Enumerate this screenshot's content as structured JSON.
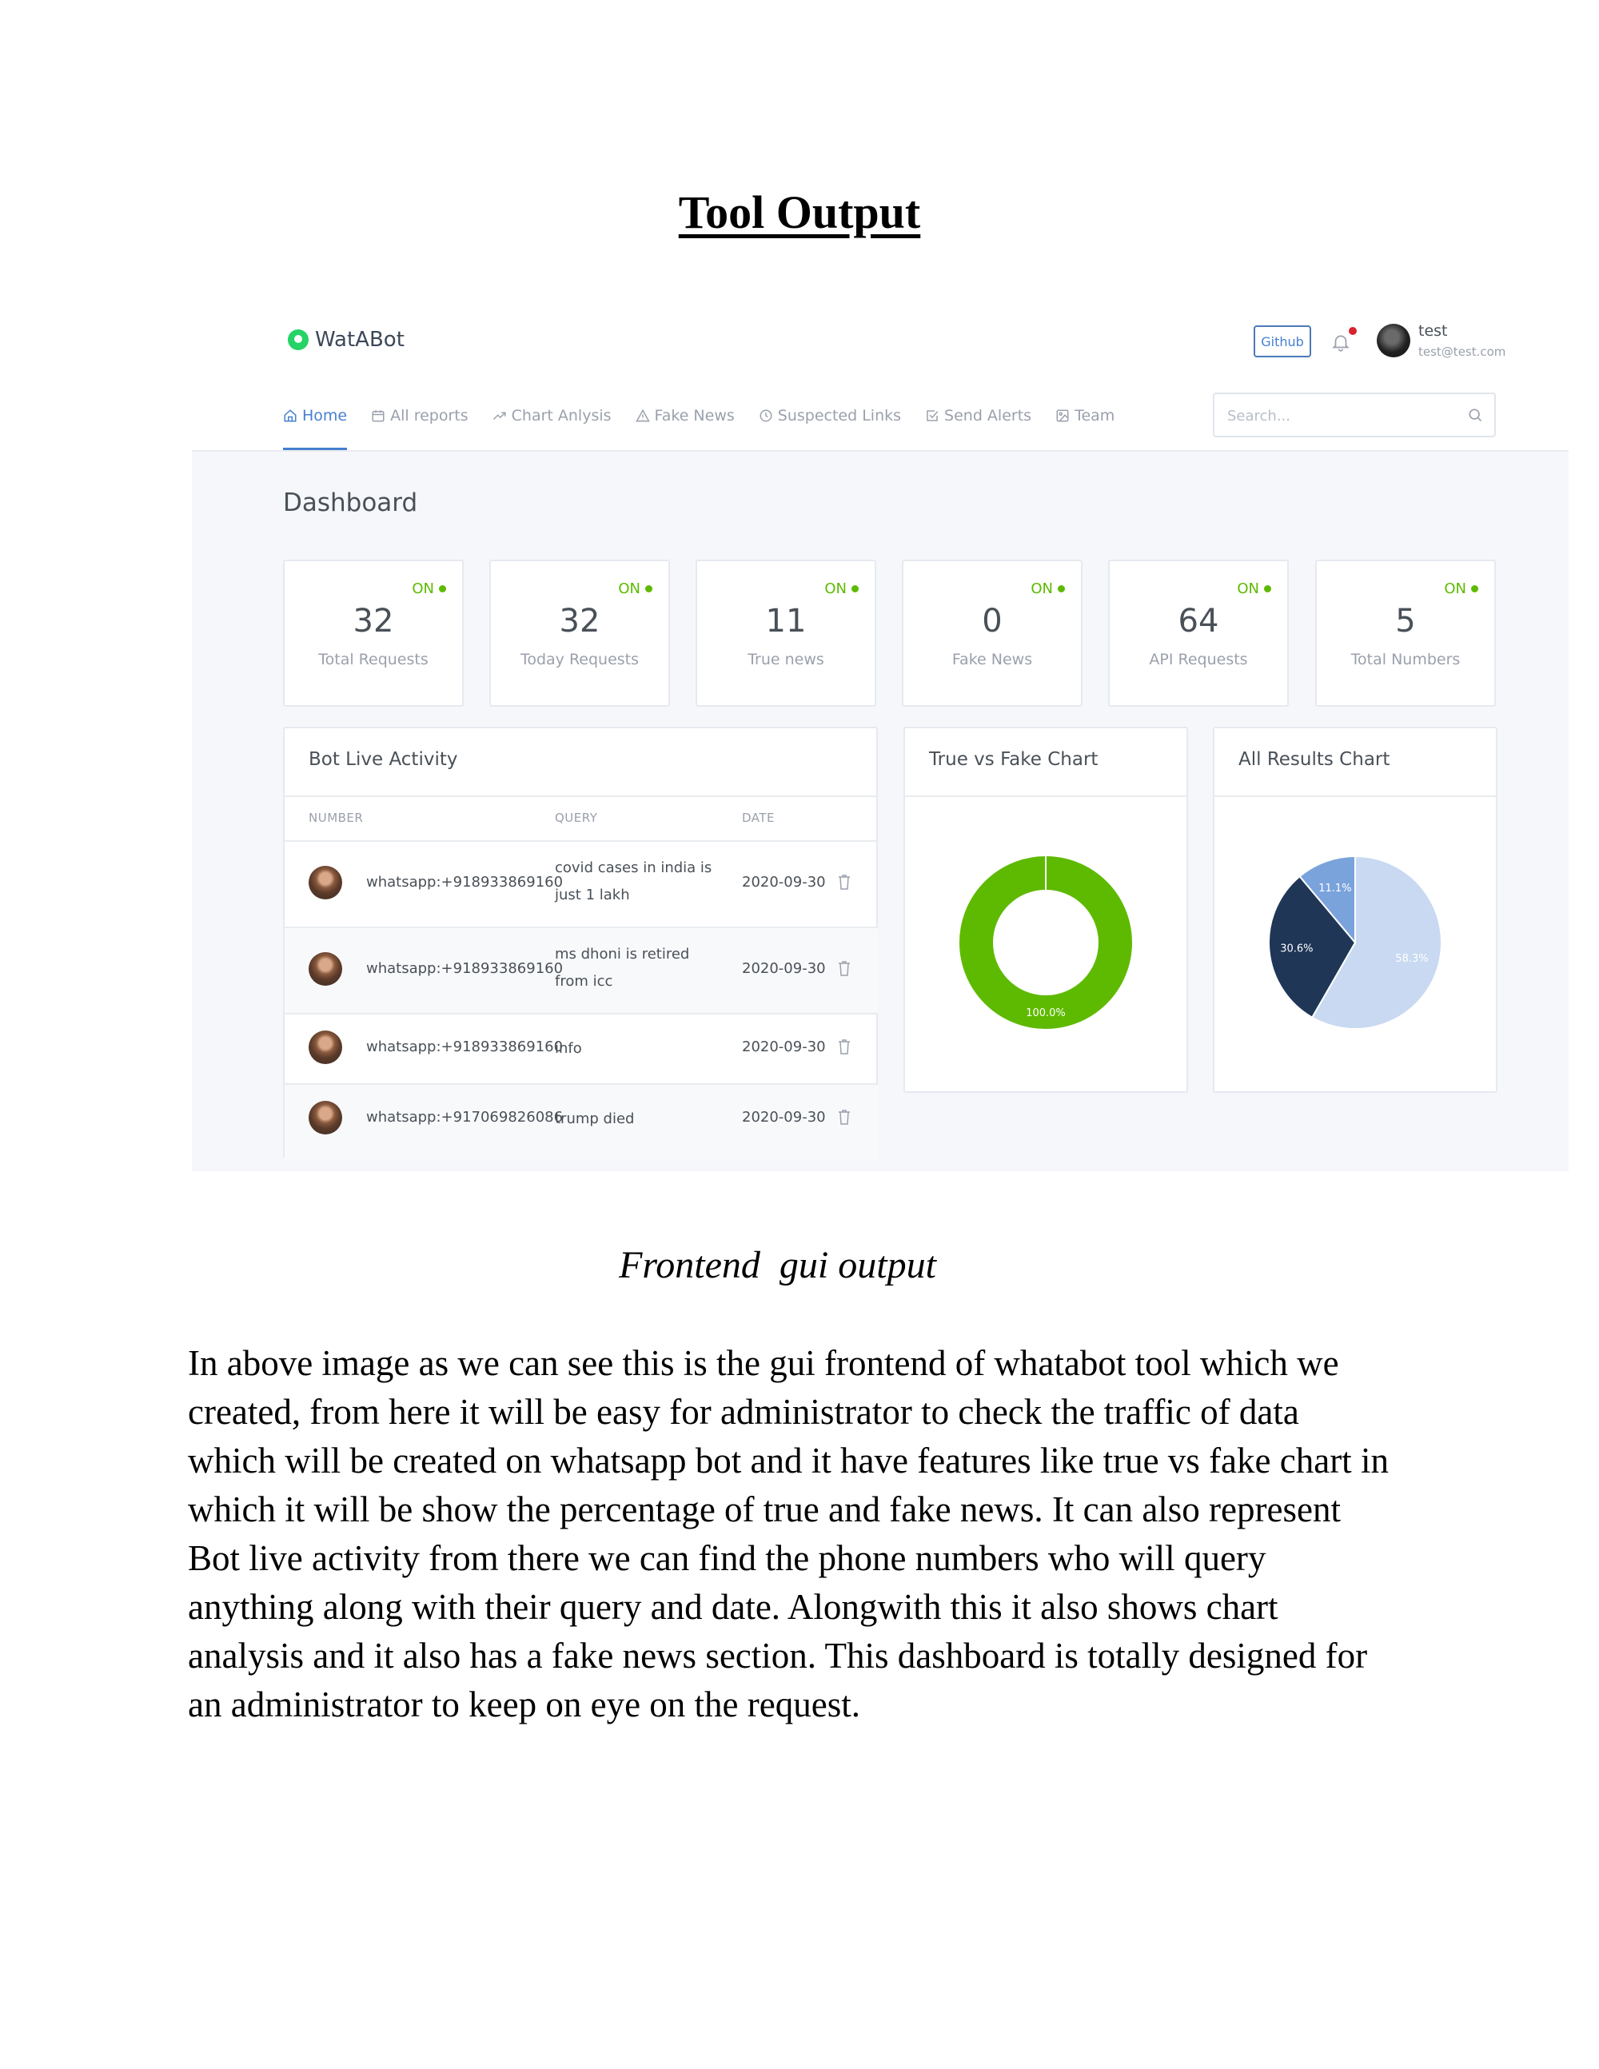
{
  "document": {
    "title": "Tool Output",
    "caption": "Frontend  gui output",
    "body_lines": [
      "In above image as we can see this is the gui frontend of whatabot tool which we",
      "created, from here it will be easy for administrator to check the traffic of data",
      "which will be created on whatsapp bot and it have features like true vs fake chart in",
      "which it will be show the percentage of true and fake news. It can also represent",
      "Bot live activity from there we can find the phone numbers who will query",
      "anything along with their query and date. Alongwith this it also shows chart",
      "analysis and it also has a fake news section. This dashboard is totally designed for",
      "an administrator to keep on eye on the request."
    ]
  },
  "app": {
    "brand": "WatABot",
    "github_label": "Github",
    "user": {
      "name": "test",
      "email": "test@test.com"
    },
    "nav": [
      {
        "label": "Home",
        "icon": "home-icon",
        "active": true
      },
      {
        "label": "All reports",
        "icon": "calendar-icon",
        "active": false
      },
      {
        "label": "Chart Anlysis",
        "icon": "trending-up-icon",
        "active": false
      },
      {
        "label": "Fake News",
        "icon": "alert-triangle-icon",
        "active": false
      },
      {
        "label": "Suspected Links",
        "icon": "clock-icon",
        "active": false
      },
      {
        "label": "Send Alerts",
        "icon": "check-square-icon",
        "active": false
      },
      {
        "label": "Team",
        "icon": "image-icon",
        "active": false
      }
    ],
    "search_placeholder": "Search...",
    "page_title": "Dashboard",
    "status_label": "ON",
    "stats": [
      {
        "value": "32",
        "label": "Total Requests"
      },
      {
        "value": "32",
        "label": "Today Requests"
      },
      {
        "value": "11",
        "label": "True news"
      },
      {
        "value": "0",
        "label": "Fake News"
      },
      {
        "value": "64",
        "label": "API Requests"
      },
      {
        "value": "5",
        "label": "Total Numbers"
      }
    ],
    "activity": {
      "title": "Bot Live Activity",
      "columns": [
        "NUMBER",
        "QUERY",
        "DATE"
      ],
      "rows": [
        {
          "number": "whatsapp:+918933869160",
          "query": "covid cases in india is just 1 lakh",
          "date": "2020-09-30"
        },
        {
          "number": "whatsapp:+918933869160",
          "query": "ms dhoni is retired from icc",
          "date": "2020-09-30"
        },
        {
          "number": "whatsapp:+918933869160",
          "query": "info",
          "date": "2020-09-30"
        },
        {
          "number": "whatsapp:+917069826086",
          "query": "trump died",
          "date": "2020-09-30"
        }
      ]
    },
    "colors": {
      "accent": "#467fcf",
      "on_green": "#5eba00",
      "donut_green": "#5eba00"
    }
  },
  "chart_data": [
    {
      "type": "pie",
      "title": "True vs Fake Chart",
      "donut": true,
      "slices": [
        {
          "value": 100.0,
          "label": "100.0%",
          "color": "#5eba00"
        }
      ]
    },
    {
      "type": "pie",
      "title": "All Results Chart",
      "donut": false,
      "slices": [
        {
          "value": 58.3,
          "label": "58.3%",
          "color": "#c8d9f1"
        },
        {
          "value": 30.6,
          "label": "30.6%",
          "color": "#1f3657"
        },
        {
          "value": 11.1,
          "label": "11.1%",
          "color": "#7aa3dc"
        }
      ]
    }
  ]
}
